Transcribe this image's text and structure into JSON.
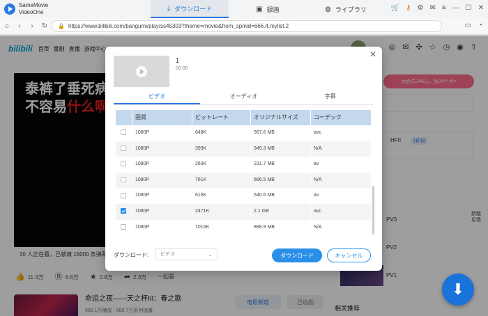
{
  "app": {
    "name_line1": "SameMovie",
    "name_line2": "VideoOne",
    "tabs": [
      {
        "label": "ダウンロード",
        "icon": "download-icon"
      },
      {
        "label": "録画",
        "icon": "record-icon"
      },
      {
        "label": "ライブラリ",
        "icon": "library-icon"
      }
    ],
    "active_tab": "ダウンロード"
  },
  "browser": {
    "url": "https://www.bilibili.com/bangumi/play/ss45303?theme=movie&from_spmid=666.4.mylist.2"
  },
  "site": {
    "logo": "bilibili",
    "nav": [
      "首页",
      "番剧",
      "直播",
      "游戏中心"
    ]
  },
  "page": {
    "subtitle_line1": "泰裤了垂死病",
    "subtitle_line2_a": "不容易",
    "subtitle_line2_b": "什么啊",
    "viewer_line": "30 人正在看，已装填 16000 条弹幕",
    "actions": [
      {
        "icon": "like-icon",
        "value": "11.3万"
      },
      {
        "icon": "coin-icon",
        "value": "8.6万"
      },
      {
        "icon": "star-icon",
        "value": "2.8万"
      },
      {
        "icon": "share-icon",
        "value": "2.3万"
      },
      {
        "icon": "",
        "value": "一起看"
      }
    ],
    "vip_promo": "大会员148元，后24个月>",
    "quality_a": "HFII",
    "quality_b": "HFIII",
    "episodes": [
      "PV3",
      "PV2",
      "PV1"
    ],
    "side_extra": "新版\n反馈",
    "related": "相关推荐",
    "rec_title": "命运之夜——天之杯III：春之歌",
    "rec_meta": "966.1万播放 · 680.7万系列追番",
    "rec_btn1": "电影频道",
    "rec_btn2": "已追剧"
  },
  "dialog": {
    "video_title": "1",
    "video_duration": "00:00",
    "tabs": [
      "ビデオ",
      "オーディオ",
      "字幕"
    ],
    "active_tab": "ビデオ",
    "columns": [
      "画質",
      "ビットレート",
      "オリジナルサイズ",
      "コーデック"
    ],
    "rows": [
      {
        "checked": false,
        "quality": "1080P",
        "bitrate": "648K",
        "size": "567.6 MB",
        "codec": "avc"
      },
      {
        "checked": false,
        "quality": "1080P",
        "bitrate": "399K",
        "size": "349.3 MB",
        "codec": "N/A"
      },
      {
        "checked": false,
        "quality": "1080P",
        "bitrate": "263K",
        "size": "231.7 MB",
        "codec": "av"
      },
      {
        "checked": false,
        "quality": "1080P",
        "bitrate": "761K",
        "size": "666.5 MB",
        "codec": "N/A"
      },
      {
        "checked": false,
        "quality": "1080P",
        "bitrate": "616K",
        "size": "540.6 MB",
        "codec": "av"
      },
      {
        "checked": true,
        "quality": "1080P",
        "bitrate": "2471K",
        "size": "2.1 GB",
        "codec": "avc"
      },
      {
        "checked": false,
        "quality": "1080P",
        "bitrate": "1016K",
        "size": "888.9 MB",
        "codec": "N/A"
      }
    ],
    "download_label": "ダウンロード:",
    "download_select": "ビデオ",
    "download_button": "ダウンロード",
    "cancel_button": "キャンセル"
  },
  "colors": {
    "accent": "#2a8fe8",
    "table_header": "#c3d8ec",
    "vip": "#ff6b8b"
  }
}
